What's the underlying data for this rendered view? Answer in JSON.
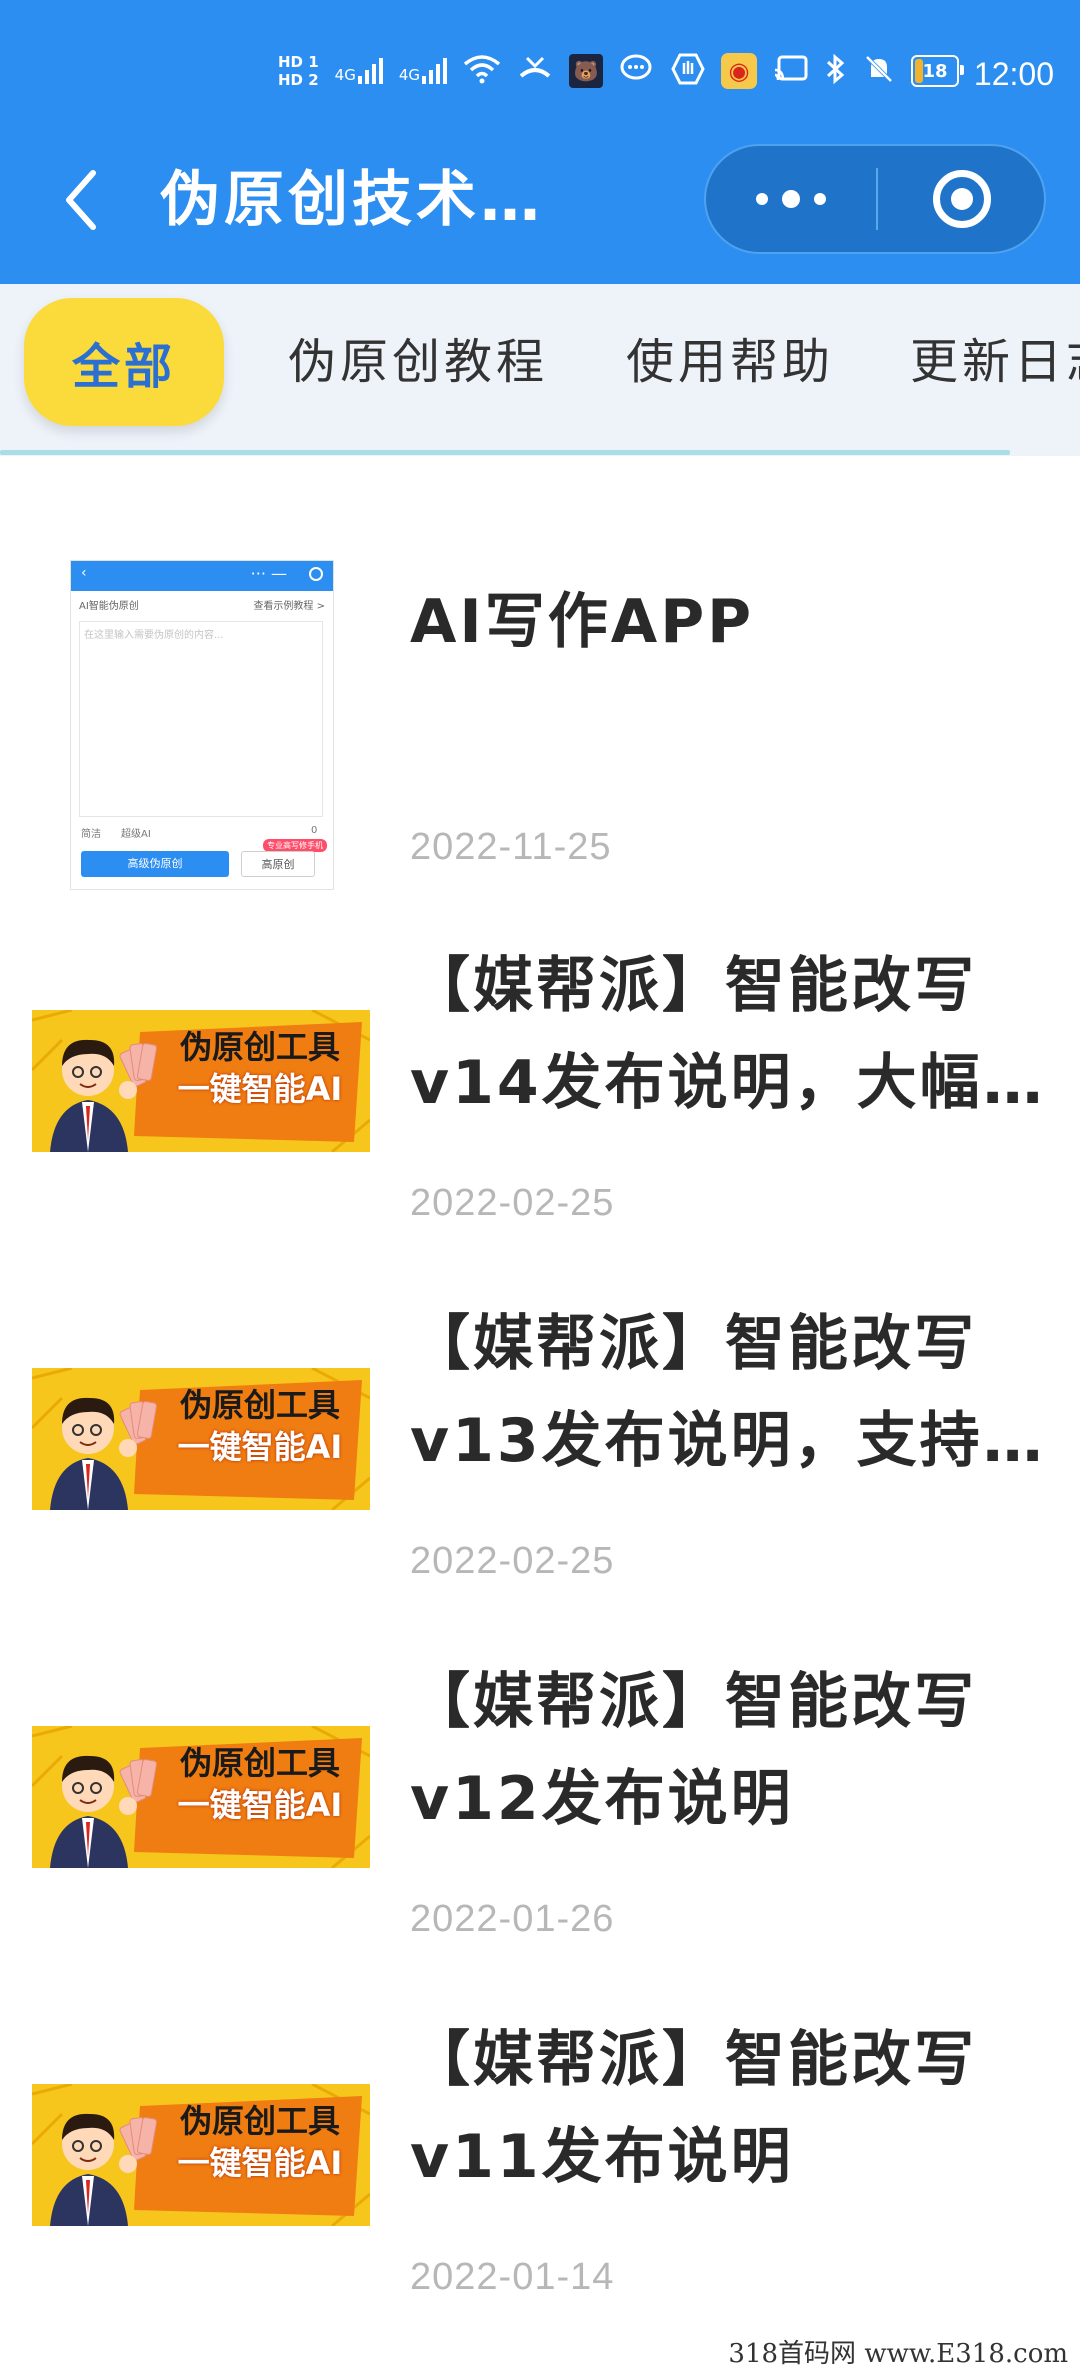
{
  "status_bar": {
    "hd1": "HD 1",
    "hd2": "HD 2",
    "net1": "4G",
    "net2": "4G",
    "battery": "18",
    "time": "12:00"
  },
  "nav": {
    "title": "伪原创技术…",
    "back_icon": "chevron-left-icon",
    "more_icon": "more-dots-icon",
    "close_icon": "target-close-icon"
  },
  "tabs": {
    "active": "全部",
    "items": [
      "伪原创教程",
      "使用帮助",
      "更新日志"
    ]
  },
  "thumb_app": {
    "title_left": "AI智能伪原创",
    "title_right": "查看示例教程 >",
    "placeholder": "在这里输入需要伪原创的内容...",
    "opt1": "简洁",
    "opt2": "超级AI",
    "count": "0",
    "btn_primary": "高级伪原创",
    "btn_secondary": "高原创",
    "badge": "专业高写修手机"
  },
  "banner": {
    "line1": "伪原创工具",
    "line2": "一键智能AI"
  },
  "articles": [
    {
      "title": "AI写作APP",
      "date": "2022-11-25"
    },
    {
      "title": "【媒帮派】智能改写v14发布说明，大幅…",
      "date": "2022-02-25"
    },
    {
      "title": "【媒帮派】智能改写v13发布说明，支持…",
      "date": "2022-02-25"
    },
    {
      "title": "【媒帮派】智能改写v12发布说明",
      "date": "2022-01-26"
    },
    {
      "title": "【媒帮派】智能改写v11发布说明",
      "date": "2022-01-14"
    }
  ],
  "watermark": "318首码网 www.E318.com",
  "colors": {
    "primary": "#2c8ef0",
    "tab_active_bg": "#fbdb3c",
    "tab_active_text": "#2a6fd1",
    "date_text": "#b7b7b7"
  }
}
